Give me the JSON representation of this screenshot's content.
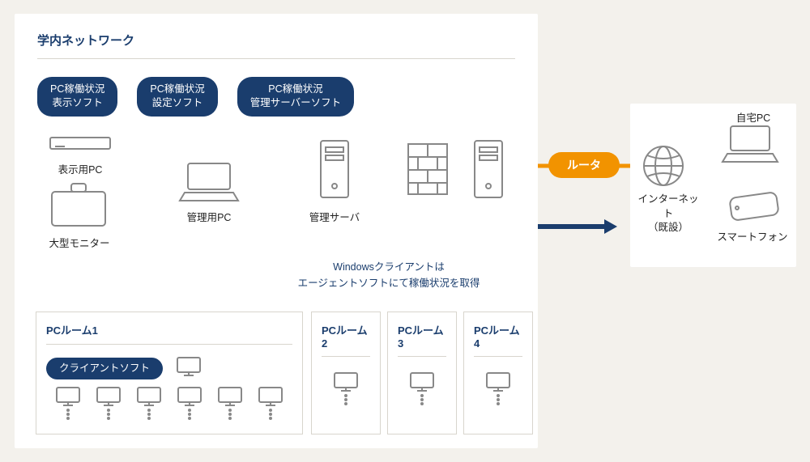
{
  "campus": {
    "title": "学内ネットワーク",
    "software_pills": [
      "PC稼働状況\n表示ソフト",
      "PC稼働状況\n設定ソフト",
      "PC稼働状況\n管理サーバーソフト"
    ],
    "devices": {
      "display_pc": "表示用PC",
      "large_monitor": "大型モニター",
      "admin_pc": "管理用PC",
      "admin_server": "管理サーバ"
    },
    "note_line1": "Windowsクライアントは",
    "note_line2": "エージェントソフトにて稼働状況を取得",
    "client_soft_pill": "クライアントソフト",
    "rooms": [
      "PCルーム1",
      "PCルーム2",
      "PCルーム3",
      "PCルーム4"
    ]
  },
  "router_label": "ルータ",
  "external": {
    "internet_line1": "インターネット",
    "internet_line2": "（既設）",
    "home_pc": "自宅PC",
    "smartphone": "スマートフォン"
  },
  "colors": {
    "navy": "#1a3d6d",
    "orange": "#f29300",
    "cyan": "#36c3e8",
    "gray": "#9a9a9a"
  }
}
